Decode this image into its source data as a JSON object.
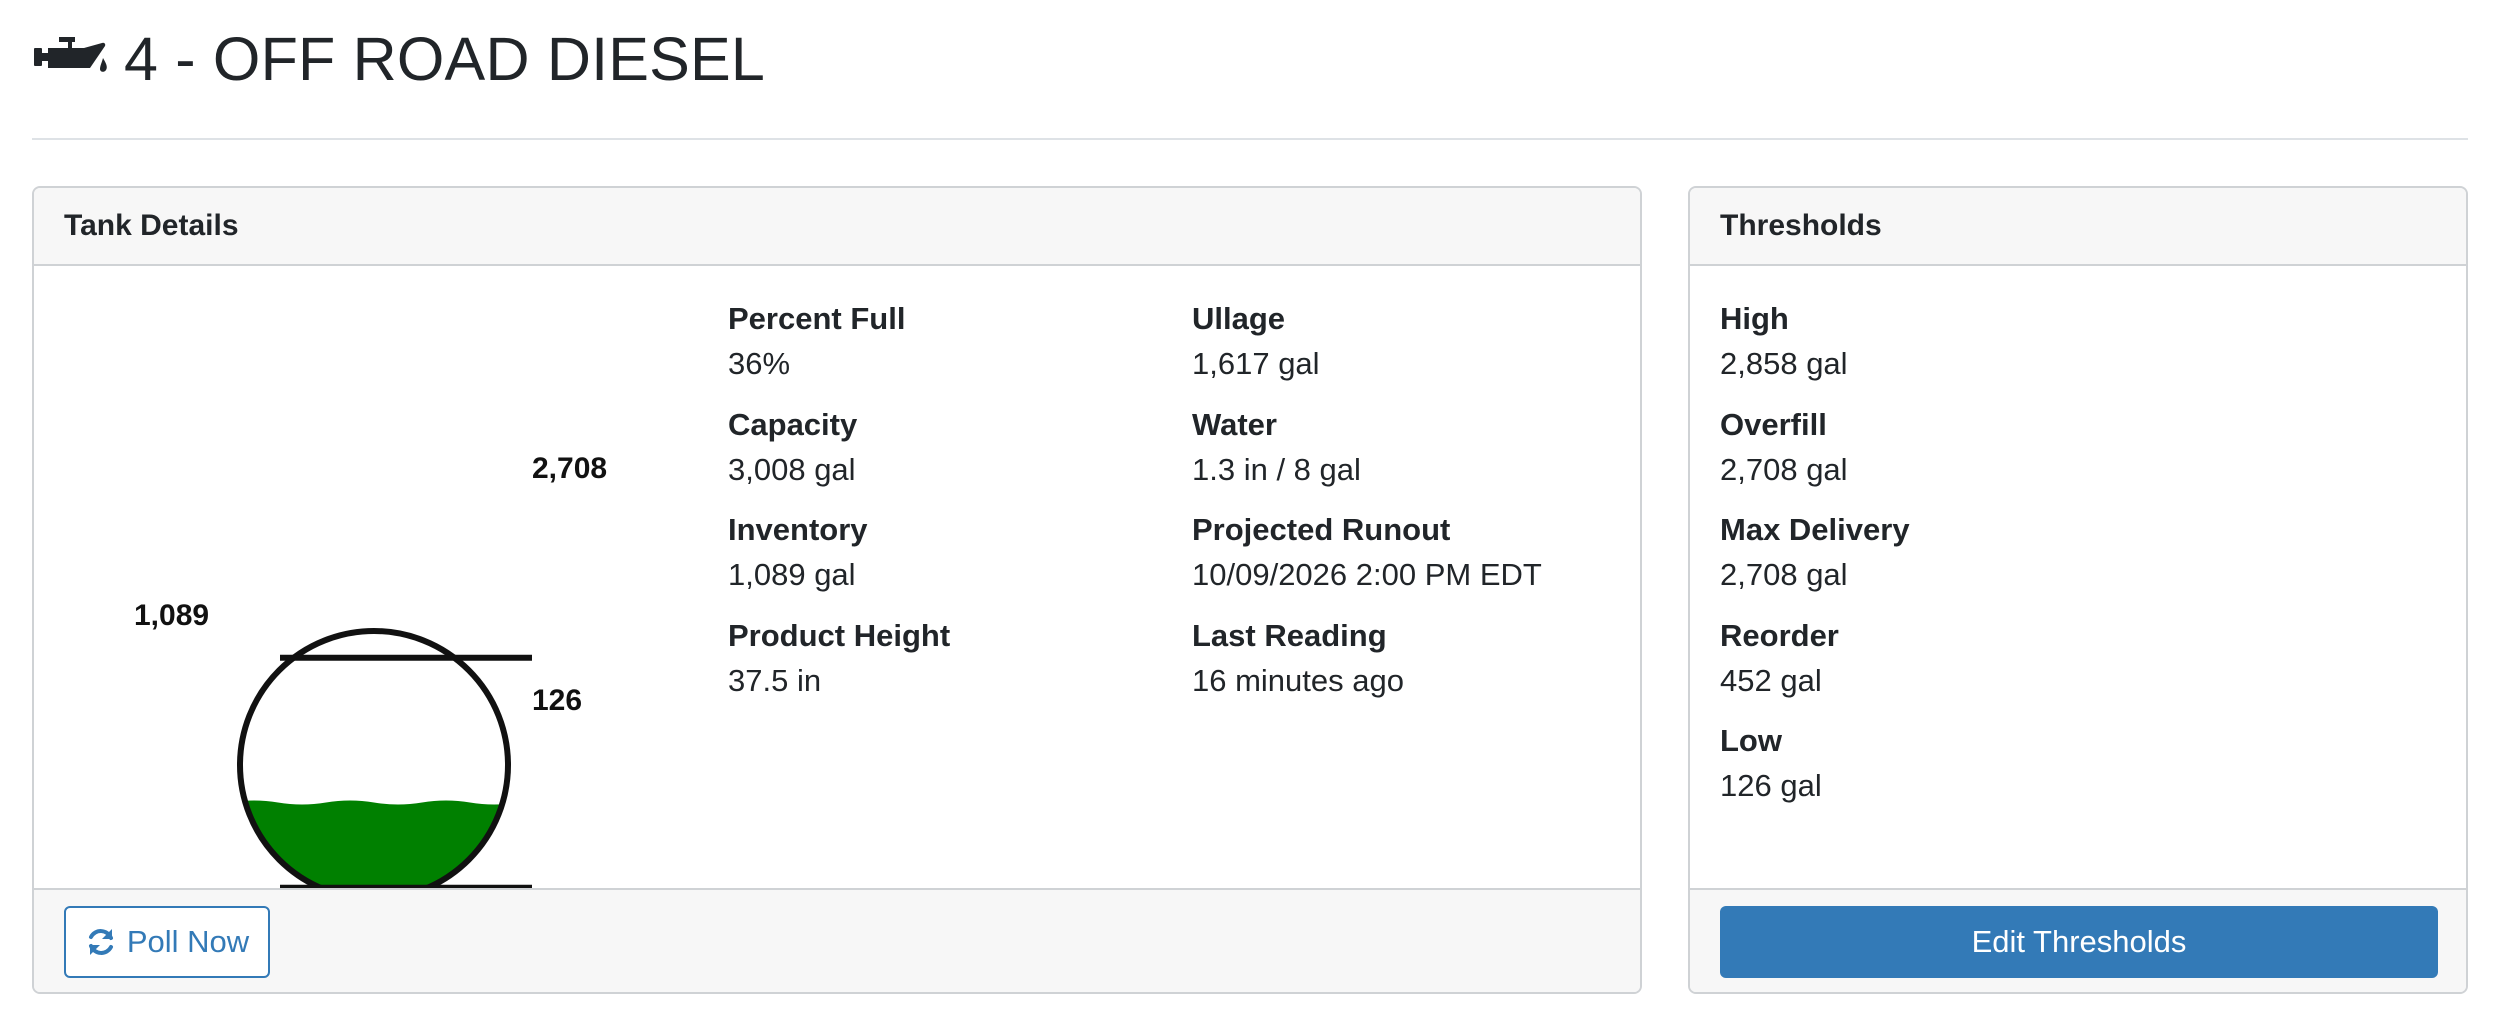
{
  "header": {
    "icon": "oil-can-icon",
    "title": "4 - OFF ROAD DIESEL"
  },
  "tank_details": {
    "title": "Tank Details",
    "gauge": {
      "top_label": "2,708",
      "current_label": "1,089",
      "bottom_label": "126",
      "fill_fraction": 0.36,
      "fill_color": "#008000",
      "top_line_fraction": 0.9,
      "bottom_line_fraction": 0.042
    },
    "fields": [
      {
        "label": "Percent Full",
        "value": "36%"
      },
      {
        "label": "Capacity",
        "value": "3,008 gal"
      },
      {
        "label": "Inventory",
        "value": "1,089 gal"
      },
      {
        "label": "Product Height",
        "value": "37.5 in"
      },
      {
        "label": "Ullage",
        "value": "1,617 gal"
      },
      {
        "label": "Water",
        "value": "1.3 in / 8 gal"
      },
      {
        "label": "Projected Runout",
        "value": "10/09/2026 2:00 PM EDT"
      },
      {
        "label": "Last Reading",
        "value": "16 minutes ago"
      }
    ],
    "poll_button": {
      "label": "Poll Now",
      "icon": "refresh-icon",
      "color": "#337ab7"
    }
  },
  "thresholds": {
    "title": "Thresholds",
    "fields": [
      {
        "label": "High",
        "value": "2,858 gal"
      },
      {
        "label": "Overfill",
        "value": "2,708 gal"
      },
      {
        "label": "Max Delivery",
        "value": "2,708 gal"
      },
      {
        "label": "Reorder",
        "value": "452 gal"
      },
      {
        "label": "Low",
        "value": "126 gal"
      }
    ],
    "edit_button": {
      "label": "Edit Thresholds",
      "color": "#337ab7"
    }
  }
}
